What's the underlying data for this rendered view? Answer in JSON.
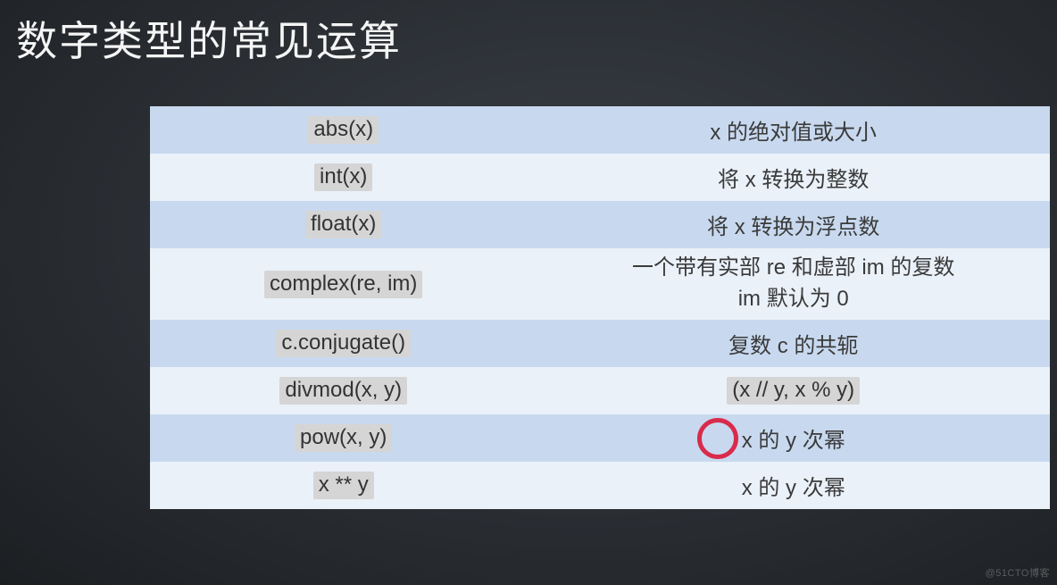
{
  "title": "数字类型的常见运算",
  "rows": [
    {
      "fn": "abs(x)",
      "desc": "x 的绝对值或大小",
      "alt": true,
      "codeFn": true,
      "codeDesc": false,
      "tall": false
    },
    {
      "fn": "int(x)",
      "desc": "将 x 转换为整数",
      "alt": false,
      "codeFn": true,
      "codeDesc": false,
      "tall": false
    },
    {
      "fn": "float(x)",
      "desc": "将 x 转换为浮点数",
      "alt": true,
      "codeFn": true,
      "codeDesc": false,
      "tall": false
    },
    {
      "fn": "complex(re, im)",
      "desc": "一个带有实部 re 和虚部 im 的复数\nim 默认为 0",
      "alt": false,
      "codeFn": true,
      "codeDesc": false,
      "tall": true
    },
    {
      "fn": "c.conjugate()",
      "desc": "复数 c 的共轭",
      "alt": true,
      "codeFn": true,
      "codeDesc": false,
      "tall": false
    },
    {
      "fn": "divmod(x, y)",
      "desc": "(x // y, x % y)",
      "alt": false,
      "codeFn": true,
      "codeDesc": true,
      "tall": false
    },
    {
      "fn": "pow(x, y)",
      "desc": "x 的 y 次幂",
      "alt": true,
      "codeFn": true,
      "codeDesc": false,
      "tall": false,
      "cursor": true
    },
    {
      "fn": "x ** y",
      "desc": "x 的 y 次幂",
      "alt": false,
      "codeFn": true,
      "codeDesc": false,
      "tall": false
    }
  ],
  "watermark": "@51CTO博客"
}
